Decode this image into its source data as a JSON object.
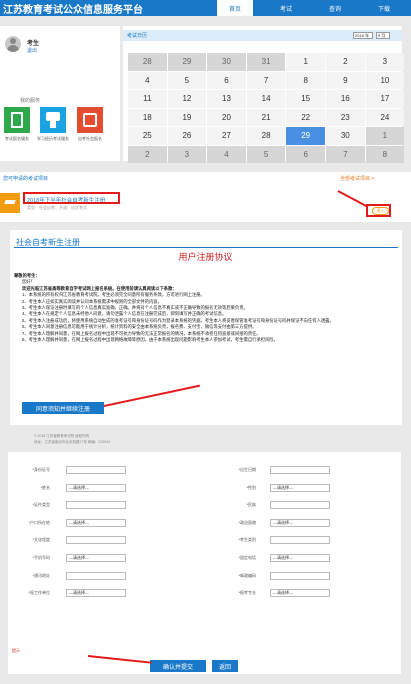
{
  "header": {
    "title": "江苏教育考试公众信息服务平台",
    "nav": [
      "首页",
      "考试",
      "查询",
      "下载"
    ]
  },
  "user": {
    "name": "考生",
    "edit": "退出"
  },
  "calendar": {
    "title": "考试日历",
    "year": "2018 年",
    "month": "9 月",
    "rows": [
      [
        "28",
        "29",
        "30",
        "31",
        "1",
        "2",
        "3"
      ],
      [
        "4",
        "5",
        "6",
        "7",
        "8",
        "9",
        "10"
      ],
      [
        "11",
        "12",
        "13",
        "14",
        "15",
        "16",
        "17"
      ],
      [
        "18",
        "19",
        "20",
        "21",
        "22",
        "23",
        "24"
      ],
      [
        "25",
        "26",
        "27",
        "28",
        "29",
        "30",
        "1"
      ],
      [
        "2",
        "3",
        "4",
        "5",
        "6",
        "7",
        "8"
      ]
    ]
  },
  "hot": {
    "title": "我的服务",
    "tiles": [
      "考试报名服务",
      "学习经历考试服务",
      "自考社会报名"
    ]
  },
  "exams": {
    "title": "您可申请的考试项目",
    "right_link": "全部考试项目 >",
    "item": "2018年下半年社会自考新生注册",
    "item_sub": "类型：社会自考；开放：自学考试",
    "action": "进入"
  },
  "register": {
    "title": "社会自考新生注册",
    "agreement_title": "用户注册协议",
    "salutation": "尊敬的考生：",
    "greeting": "您好！",
    "paragraphs": [
      "欢迎光临江苏省高等教育自学考试网上报名系统。在使用前请认真阅读以下条款：",
      "1、本系统的所有权归江苏省教育考试院。考生必须完全同意所有服务条款，方可进行网上注册。",
      "2、考生本人应如实真实阅读并认同本系统需求中规则的全部文件的内容。",
      "3、考生本人保证注册时填写的个人信息真实准确，正确。并将对个人信息不真实或不正确导致的报名无效等后果负责。",
      "4、考生本人在规定个人信息未经他人同意，请勿泄露个人信息在注册完成后，即刻填写并正确的考试信息。",
      "5、考生本人注册成功后，将使用系统自动生成的准考证号和身份证号码作为登录本系统的凭据，考生本人将妥善保管准考证号和身份证号码并保证不向任何人透露。",
      "6、考生本人同意注册信息可能用于统计分析，统计资料的安全由本系统负责，报名费、支付宝，微信等支付由第三方提供。",
      "7、考生本人理解并同意，在网上报名过程中出现不可抗力导致的无法正常报名的情况，本系统不承担任何直接或间接的责任。",
      "8、考生本人理解并同意，在网上报名过程中出现网络故障等原因，由于本系统出现问题影响考生本人参加考试，考生需自行承担风险。"
    ],
    "agree_btn": "同意须知并继续注册"
  },
  "footer": {
    "copyright": "© 2018 江苏省教育考试院 版权所有",
    "address": "地址：江苏省南京市北京西路77号 邮编：210024"
  },
  "form": {
    "fields": [
      "*身份证号",
      "*出生日期",
      "*姓名",
      "*性别",
      "*证件类型",
      "*民族",
      "*户口所在地",
      "*政治面貌",
      "*文化程度",
      "*考生类别",
      "*手机号码",
      "*固定电话",
      "*通讯地址",
      "*邮政编码",
      "*现工作单位",
      "*报考专业"
    ],
    "placeholder": "---请选择---",
    "submit": "确认并提交",
    "reset": "返回",
    "note": "提示"
  }
}
